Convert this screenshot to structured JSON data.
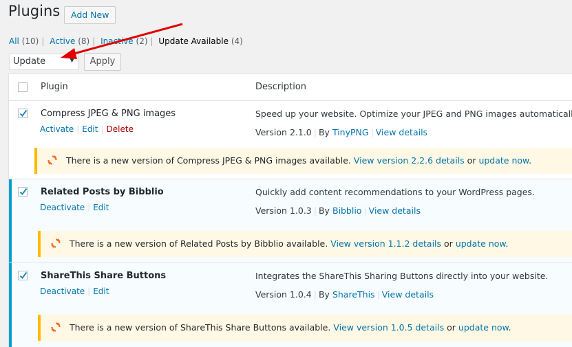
{
  "header": {
    "title": "Plugins",
    "add_new": "Add New"
  },
  "filters": {
    "all_label": "All",
    "all_count": "(10)",
    "active_label": "Active",
    "active_count": "(8)",
    "inactive_label": "Inactive",
    "inactive_count": "(2)",
    "update_label": "Update Available",
    "update_count": "(4)"
  },
  "bulk": {
    "selected": "Update",
    "apply": "Apply"
  },
  "table": {
    "col_plugin": "Plugin",
    "col_description": "Description"
  },
  "plugins": [
    {
      "name": "Compress JPEG & PNG images",
      "action1": "Activate",
      "action2": "Edit",
      "action3": "Delete",
      "description": "Speed up your website. Optimize your JPEG and PNG images automatically with",
      "version": "Version 2.1.0",
      "by": "By",
      "author": "TinyPNG",
      "details": "View details",
      "notice_text": "There is a new version of Compress JPEG & PNG images available.",
      "notice_link": "View version 2.2.6 details",
      "notice_or": "or",
      "notice_update": "update now",
      "notice_end": "."
    },
    {
      "name": "Related Posts by Bibblio",
      "action1": "Deactivate",
      "action2": "Edit",
      "description": "Quickly add content recommendations to your WordPress pages.",
      "version": "Version 1.0.3",
      "by": "By",
      "author": "Bibblio",
      "details": "View details",
      "notice_text": "There is a new version of Related Posts by Bibblio available.",
      "notice_link": "View version 1.1.2 details",
      "notice_or": "or",
      "notice_update": "update now",
      "notice_end": "."
    },
    {
      "name": "ShareThis Share Buttons",
      "action1": "Deactivate",
      "action2": "Edit",
      "description": "Integrates the ShareThis Sharing Buttons directly into your website.",
      "version": "Version 1.0.4",
      "by": "By",
      "author": "ShareThis",
      "details": "View details",
      "notice_text": "There is a new version of ShareThis Share Buttons available.",
      "notice_link": "View version 1.0.5 details",
      "notice_or": "or",
      "notice_update": "update now",
      "notice_end": "."
    }
  ],
  "colors": {
    "link": "#0073aa",
    "active_bar": "#00a0d2",
    "notice_border": "#ffb900",
    "notice_bg": "#fff8e5",
    "annotation_arrow": "#e00000"
  }
}
